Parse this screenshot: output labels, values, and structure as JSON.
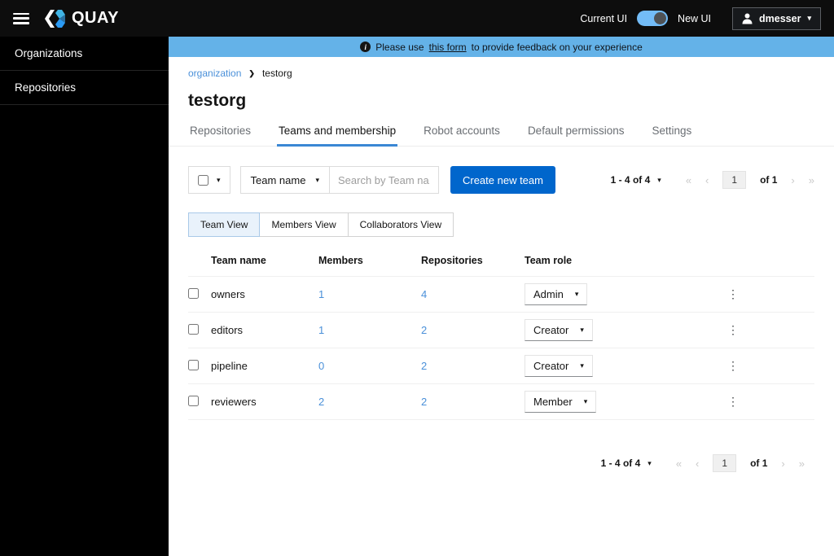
{
  "header": {
    "brand": "QUAY",
    "ui_toggle": {
      "left_label": "Current UI",
      "right_label": "New UI",
      "state": "on"
    },
    "user": {
      "name": "dmesser"
    }
  },
  "sidebar": {
    "items": [
      {
        "label": "Organizations"
      },
      {
        "label": "Repositories"
      }
    ]
  },
  "banner": {
    "text_before_link": "Please use",
    "link_text": "this form",
    "text_after_link": "to provide feedback on your experience"
  },
  "breadcrumb": {
    "link": "organization",
    "current": "testorg"
  },
  "page": {
    "title": "testorg"
  },
  "tabs": [
    {
      "label": "Repositories",
      "active": false
    },
    {
      "label": "Teams and membership",
      "active": true
    },
    {
      "label": "Robot accounts",
      "active": false
    },
    {
      "label": "Default permissions",
      "active": false
    },
    {
      "label": "Settings",
      "active": false
    }
  ],
  "toolbar": {
    "filter_label": "Team name",
    "search_placeholder": "Search by Team na...",
    "create_button_label": "Create new team"
  },
  "view_toggle": {
    "options": [
      {
        "label": "Team View",
        "selected": true
      },
      {
        "label": "Members View",
        "selected": false
      },
      {
        "label": "Collaborators View",
        "selected": false
      }
    ]
  },
  "pagination": {
    "range": "1 - 4 of 4",
    "current_page": "1",
    "page_count_label": "of 1",
    "first_arrow": "«",
    "prev_arrow": "‹",
    "next_arrow": "›",
    "last_arrow": "»"
  },
  "table": {
    "columns": [
      "Team name",
      "Members",
      "Repositories",
      "Team role"
    ],
    "rows": [
      {
        "name": "owners",
        "members": "1",
        "repositories": "4",
        "role": "Admin"
      },
      {
        "name": "editors",
        "members": "1",
        "repositories": "2",
        "role": "Creator"
      },
      {
        "name": "pipeline",
        "members": "0",
        "repositories": "2",
        "role": "Creator"
      },
      {
        "name": "reviewers",
        "members": "2",
        "repositories": "2",
        "role": "Member"
      }
    ]
  },
  "icons": {
    "caret_down": "▾",
    "kebab": "⋮",
    "breadcrumb_separator": "❯",
    "info": "i",
    "hamburger": "hamburger-menu",
    "user": "person",
    "logo": "quay-double-chevron"
  },
  "colors": {
    "primary_blue": "#0066cc",
    "link_blue": "#4a90d9",
    "banner_blue": "#64b2e8",
    "tab_indicator_blue": "#3a87d4",
    "toggle_pill": "#73bcf7",
    "toggle_knob": "#4f5255",
    "header_bg": "#0d0d0d",
    "sidebar_bg": "#000000"
  }
}
